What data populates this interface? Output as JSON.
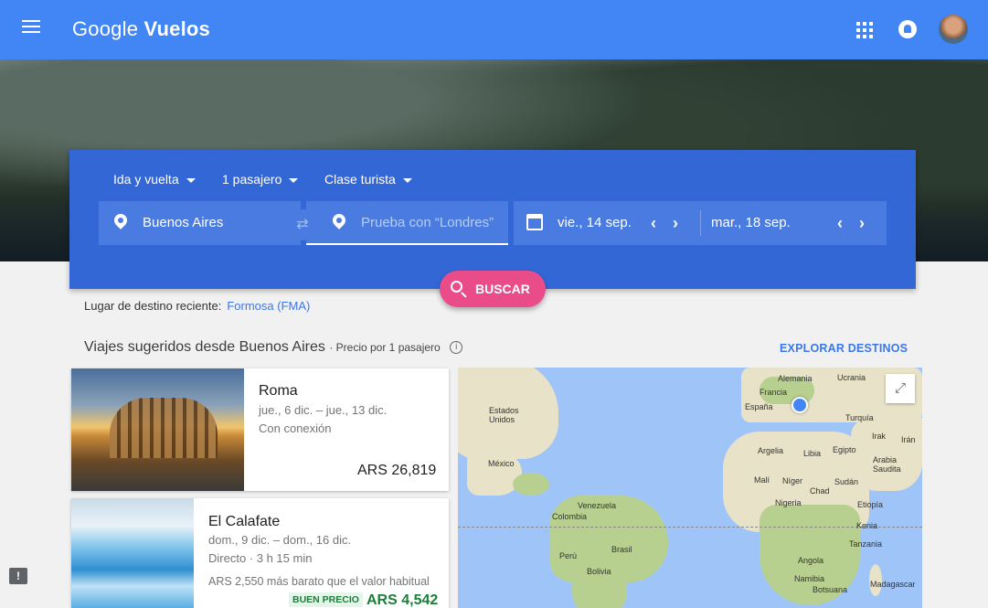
{
  "app": {
    "title_light": "Google",
    "title_bold": "Vuelos"
  },
  "search": {
    "trip_type": "Ida y vuelta",
    "passengers": "1 pasajero",
    "cabin": "Clase turista",
    "origin": "Buenos Aires",
    "destination_placeholder": "Prueba con “Londres”",
    "depart_date": "vie., 14 sep.",
    "return_date": "mar., 18 sep.",
    "search_label": "BUSCAR"
  },
  "recent": {
    "label": "Lugar de destino reciente:",
    "link": "Formosa (FMA)"
  },
  "suggestions": {
    "title": "Viajes sugeridos desde Buenos Aires",
    "subtitle": "· Precio por 1 pasajero",
    "explore": "EXPLORAR DESTINOS",
    "cards": [
      {
        "city": "Roma",
        "dates": "jue., 6 dic. – jue., 13 dic.",
        "stops": "Con conexión",
        "price": "ARS 26,819"
      },
      {
        "city": "El Calafate",
        "dates": "dom., 9 dic. – dom., 16 dic.",
        "stops": "Directo · 3 h 15 min",
        "note": "ARS 2,550 más barato que el valor habitual",
        "badge": "BUEN PRECIO",
        "price": "ARS 4,542"
      }
    ]
  },
  "map": {
    "labels": {
      "alemania": "Alemania",
      "ucrania": "Ucrania",
      "francia": "Francia",
      "espana": "España",
      "turquia": "Turquía",
      "irak": "Irak",
      "iran": "Irán",
      "argelia": "Argelia",
      "libia": "Libia",
      "egipto": "Egipto",
      "arabia": "Arabia Saudita",
      "mali": "Malí",
      "niger": "Níger",
      "sudan": "Sudán",
      "chad": "Chad",
      "nigeria": "Nigeria",
      "etiopia": "Etiopía",
      "kenia": "Kenia",
      "tanzania": "Tanzania",
      "angola": "Angola",
      "namibia": "Namibia",
      "botsuana": "Botsuana",
      "madagascar": "Madagascar",
      "eeuu": "Estados Unidos",
      "mexico": "México",
      "venezuela": "Venezuela",
      "colombia": "Colombia",
      "brasil": "Brasil",
      "peru": "Perú",
      "bolivia": "Bolivia"
    }
  },
  "colors": {
    "appbar": "#4285f4",
    "panel": "#3367d6",
    "field": "#4a7be0",
    "accent": "#ea4c89",
    "link": "#3b78e7"
  }
}
